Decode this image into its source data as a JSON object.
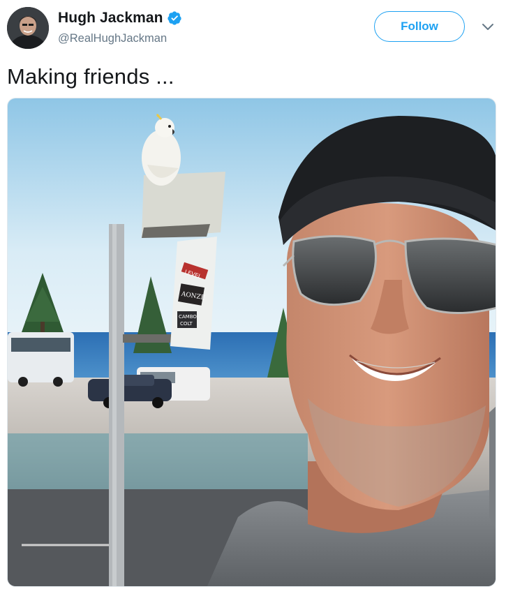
{
  "tweet": {
    "author": {
      "display_name": "Hugh Jackman",
      "handle": "@RealHughJackman",
      "verified": true,
      "avatar_icon": "user-avatar"
    },
    "follow_label": "Follow",
    "menu_icon": "chevron-down-icon",
    "text": "Making friends ...",
    "media": {
      "description_icon": "photo",
      "sign_texts": [
        "LEVEL",
        "AONZE",
        "CAMBO",
        "COLT"
      ]
    }
  },
  "colors": {
    "brand_blue": "#1da1f2",
    "text_primary": "#14171a",
    "text_secondary": "#657786"
  }
}
